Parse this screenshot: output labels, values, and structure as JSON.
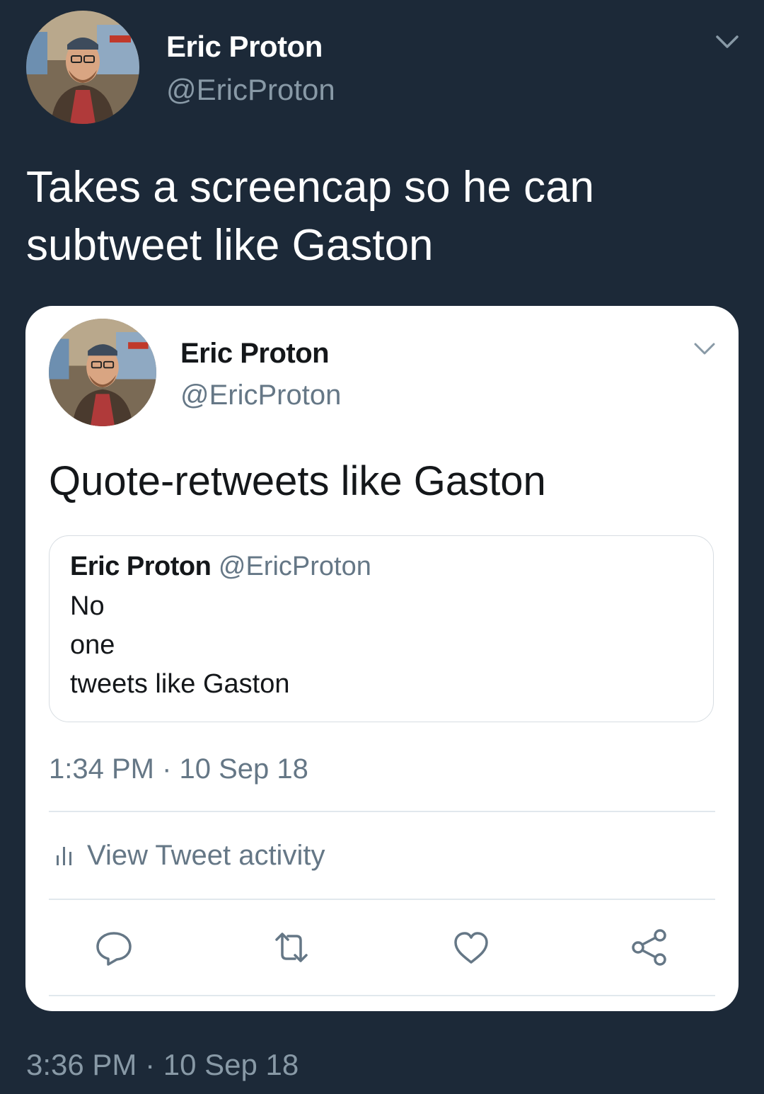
{
  "outer_tweet": {
    "display_name": "Eric Proton",
    "handle": "@EricProton",
    "text_lines": [
      "Takes a screencap so he can",
      "subtweet like Gaston"
    ],
    "timestamp": "3:36 PM · 10 Sep 18",
    "avatar_icon": "user-avatar-photo",
    "menu_icon": "chevron-down-icon"
  },
  "embedded_screenshot": {
    "display_name": "Eric Proton",
    "handle": "@EricProton",
    "text": "Quote-retweets like Gaston",
    "avatar_icon": "user-avatar-photo",
    "menu_icon": "chevron-down-icon",
    "quoted_tweet": {
      "display_name": "Eric Proton",
      "handle": "@EricProton",
      "lines": [
        "No",
        "one",
        "tweets like Gaston"
      ]
    },
    "timestamp": "1:34 PM · 10 Sep 18",
    "activity_label": "View Tweet activity",
    "actions": [
      "reply-icon",
      "retweet-icon",
      "like-icon",
      "share-icon"
    ]
  },
  "colors": {
    "background": "#1c2938",
    "card_background": "#ffffff",
    "secondary_text_dark": "#8899a6",
    "secondary_text_light": "#657786"
  }
}
